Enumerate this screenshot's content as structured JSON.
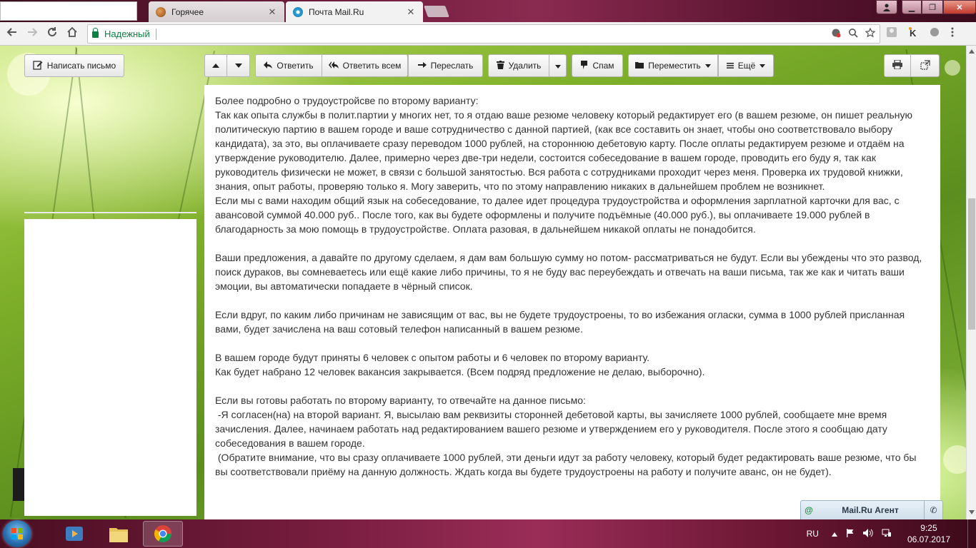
{
  "browser": {
    "tabs": [
      {
        "title": "",
        "active": false
      },
      {
        "title": "Горячее",
        "active": false
      },
      {
        "title": "Почта Mail.Ru",
        "active": true
      }
    ],
    "close_glyph": "✕",
    "security_label": "Надежный",
    "window_controls": {
      "minimize": "▁",
      "maximize": "❐",
      "close": "✕"
    }
  },
  "mail": {
    "compose_label": "Написать письмо",
    "toolbar": {
      "reply": "Ответить",
      "reply_all": "Ответить всем",
      "forward": "Переслать",
      "delete": "Удалить",
      "spam": "Спам",
      "move": "Переместить",
      "more": "Ещё"
    },
    "letter_paragraphs": [
      "Более подробно о трудоустройсве по второму варианту:\nТак как опыта службы в полит.партии у многих нет, то я отдаю ваше резюме человеку который редактирует его (в вашем резюме, он пишет реальную политическую партию в вашем городе и ваше сотрудничество с данной партией, (как все составить он знает, чтобы оно соответствовало выбору кандидата), за это, вы оплачиваете сразу переводом 1000 рублей, на стороннюю дебетовую карту. После оплаты редактируем резюме и отдаём на утверждение руководителю. Далее, примерно через две-три недели, состоится собеседование в вашем городе, проводить его буду я, так как руководитель физически не может, в связи с большой занятостью. Вся работа с сотрудниками проходит через меня. Проверка их трудовой книжки, знания, опыт работы, проверяю только я. Могу заверить, что по этому направлению никаких в дальнейшем проблем не возникнет.\nЕсли мы с вами находим общий язык на собеседование, то далее идет процедура трудоустройства и оформления зарплатной карточки для вас, с авансовой суммой 40.000 руб.. После того, как вы будете оформлены и получите подъёмные (40.000 руб.), вы оплачиваете 19.000 рублей в благодарность за мою помощь в трудоустройстве. Оплата разовая, в дальнейшем никакой оплаты не понадобится.",
      "Ваши предложения, а давайте по другому сделаем, я дам вам большую сумму но потом- рассматриваться не будут. Если вы убеждены что это развод, поиск дураков, вы сомневаетесь или ещё какие либо причины, то я не буду вас переубеждать и отвечать на ваши письма, так же как и читать ваши эмоции, вы автоматически попадаете в чёрный список.",
      "Если вдруг, по каким либо причинам не зависящим от вас, вы не будете трудоустроены, то во избежания огласки, сумма в 1000 рублей присланная вами, будет зачислена на ваш сотовый телефон написанный в вашем резюме.",
      "В вашем городе будут приняты 6 человек с опытом работы и 6 человек по второму варианту.\nКак будет набрано 12 человек вакансия закрывается. (Всем подряд предложение не делаю, выборочно).",
      "Если вы готовы работать по второму варианту, то отвечайте на данное письмо:\n -Я согласен(на) на второй вариант. Я, высылаю вам реквизиты сторонней дебетовой карты, вы зачисляете 1000 рублей, сообщаете мне время зачисления. Далее, начинаем работать над редактированием вашего резюме и утверждением его у руководителя. После этого я сообщаю дату собеседования в вашем городе.\n (Обратите внимание, что вы сразу оплачиваете 1000 рублей, эти деньги идут за работу человеку, который будет редактировать ваше резюме, что бы вы соответствовали приёму на данную должность. Ждать когда вы будете трудоустроены на работу и получите аванс, он не будет)."
    ],
    "agent": {
      "label": "Mail.Ru Агент",
      "at_glyph": "@",
      "phone_glyph": "✆"
    }
  },
  "taskbar": {
    "language": "RU",
    "time": "9:25",
    "date": "06.07.2017"
  },
  "icons": [
    "back-icon",
    "forward-icon",
    "reload-icon",
    "home-icon",
    "lock-icon",
    "cookie-icon",
    "zoom-icon",
    "star-icon",
    "up-arrow-icon",
    "down-arrow-icon",
    "reply-icon",
    "reply-all-icon",
    "forward-mail-icon",
    "trash-icon",
    "spam-icon",
    "folder-icon",
    "menu-icon",
    "print-icon",
    "popout-icon"
  ],
  "colors": {
    "secure_green": "#0b8043",
    "letter_bg": "#ffffff",
    "grass_green": "#7fb02a"
  }
}
